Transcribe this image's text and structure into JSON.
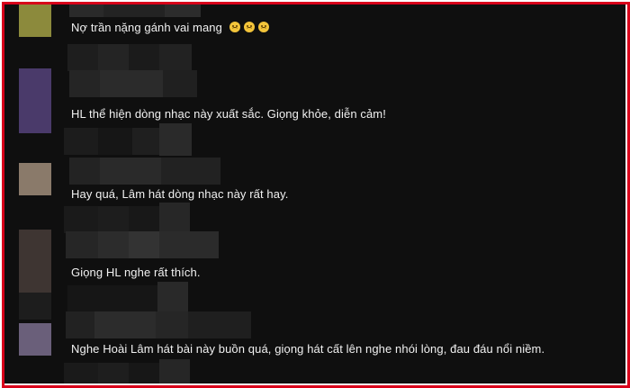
{
  "colors": {
    "background": "#0f0f0f",
    "text": "#f1f1f1",
    "frame": "#d8001a"
  },
  "comments": [
    {
      "text": "Nợ trần nặng gánh vai mang",
      "emoji": [
        "worried-face-icon",
        "worried-face-icon",
        "worried-face-icon"
      ],
      "avatar_color": "#8c8a3c"
    },
    {
      "text": "HL thể hiện dòng nhạc này xuất sắc.  Giọng khỏe,  diễn cảm!",
      "avatar_color": "#4a3a6a"
    },
    {
      "text": "Hay quá, Lâm hát dòng nhạc này rất hay.",
      "avatar_color": "#8a7a6a"
    },
    {
      "text": "Giọng HL nghe rất thích.",
      "avatar_color": "#4a3f3a"
    },
    {
      "text": "Nghe Hoài Lâm hát bài này buồn quá, giọng hát cất lên nghe nhói lòng, đau đáu nổi niềm.",
      "avatar_color": "#6a5f7a"
    }
  ]
}
